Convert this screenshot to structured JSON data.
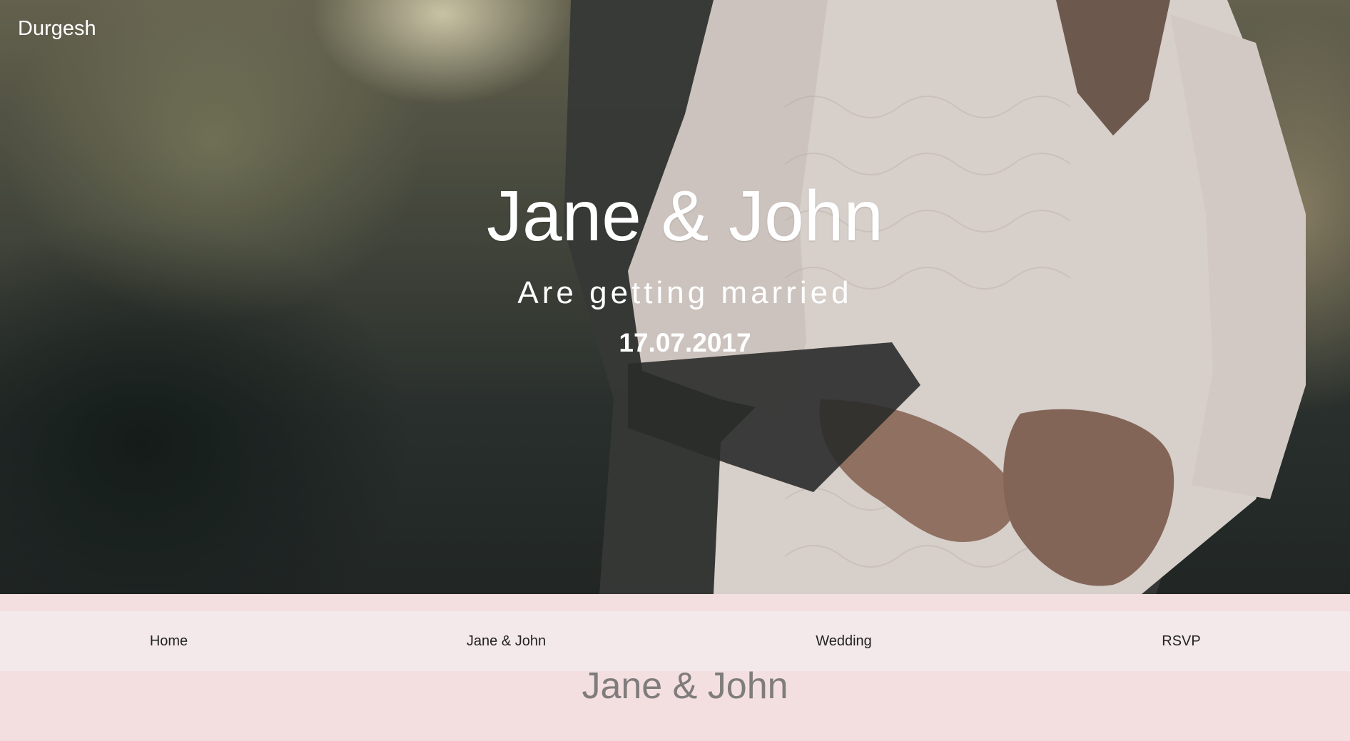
{
  "brand": {
    "name": "Durgesh"
  },
  "hero": {
    "title": "Jane & John",
    "subtitle": "Are getting married",
    "date": "17.07.2017"
  },
  "nav": {
    "items": [
      {
        "label": "Home"
      },
      {
        "label": "Jane & John"
      },
      {
        "label": "Wedding"
      },
      {
        "label": "RSVP"
      }
    ]
  },
  "section": {
    "title": "Jane & John"
  },
  "colors": {
    "page_background": "#f4dfe0",
    "navbar_background": "#f3e9ea",
    "hero_text": "#ffffff",
    "section_title": "#7f7c7c"
  }
}
